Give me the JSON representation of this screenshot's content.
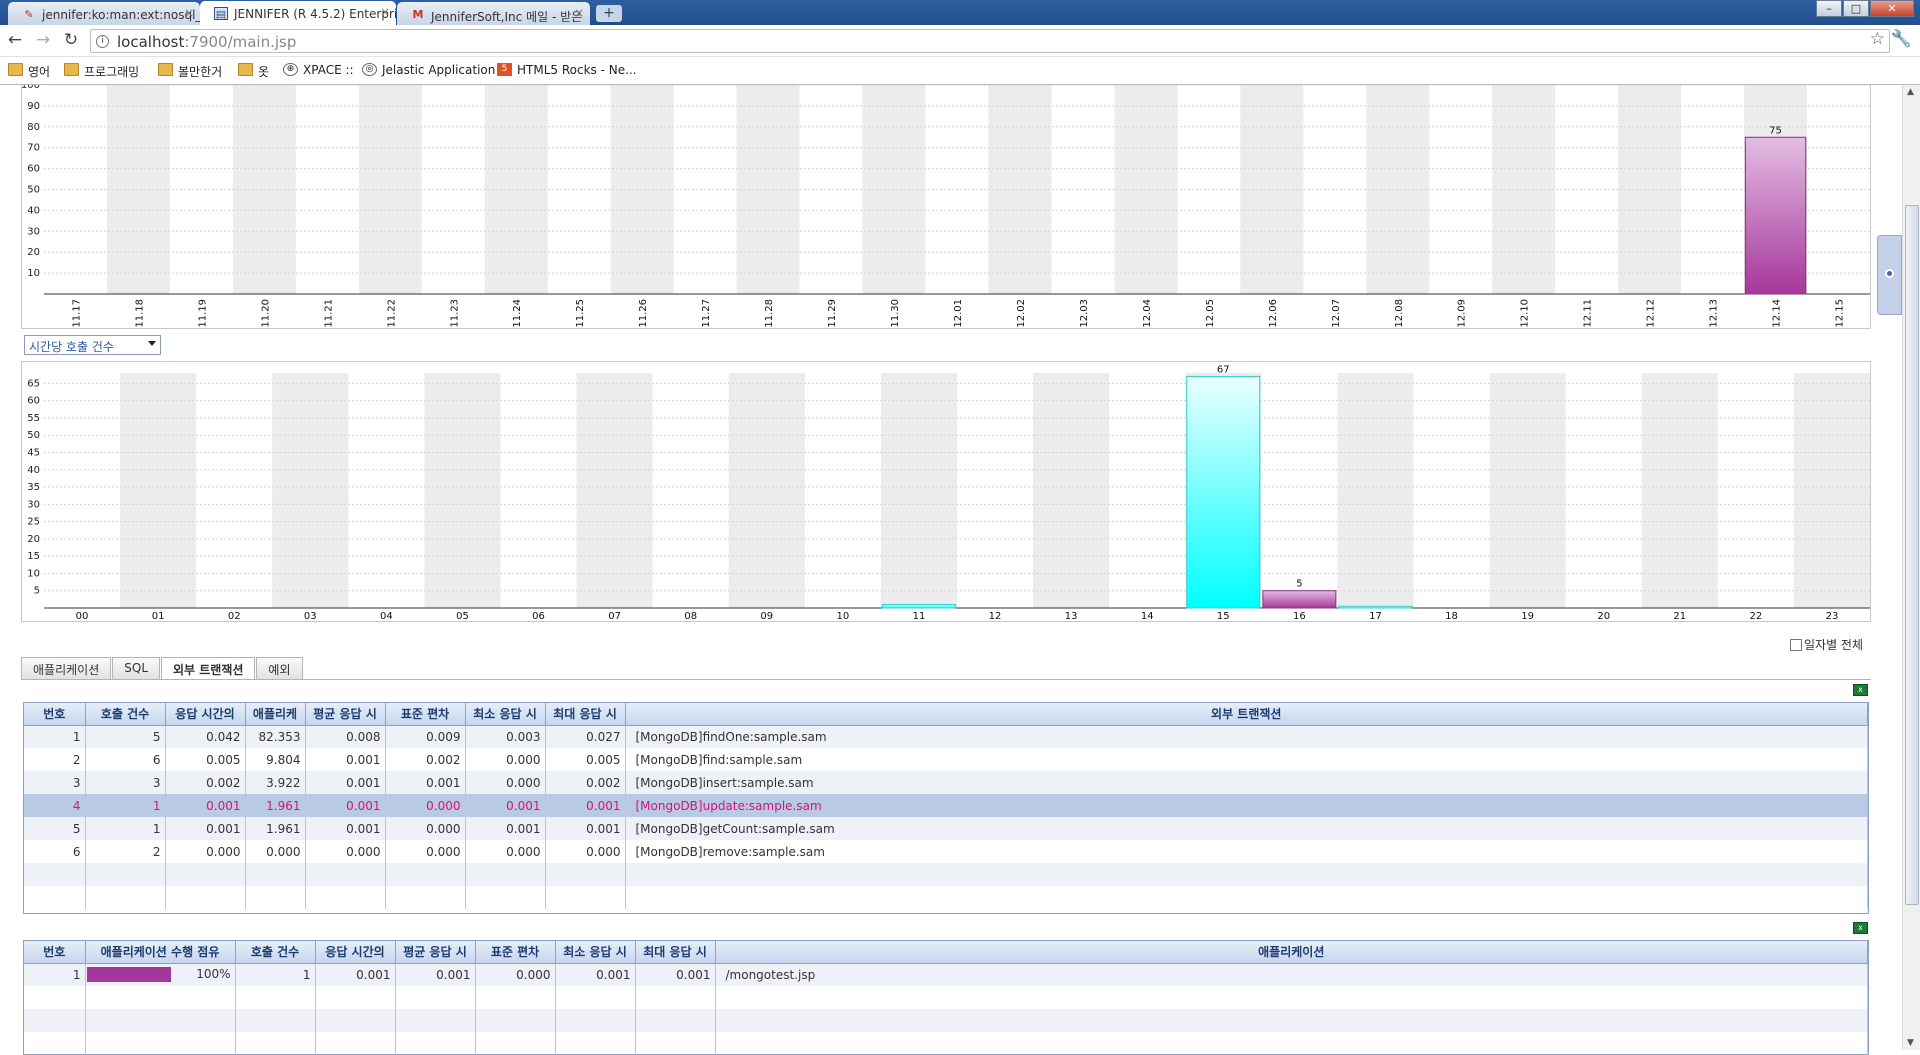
{
  "browser": {
    "tabs": [
      {
        "title": "jennifer:ko:man:ext:nosql_n",
        "icon": "doc-icon"
      },
      {
        "title": "JENNIFER (R 4.5.2) Enterpri",
        "icon": "monitor-icon"
      },
      {
        "title": "JenniferSoft,Inc 메일 - 받은",
        "icon": "mail-icon"
      }
    ],
    "url_host": "localhost",
    "url_rest": ":7900/main.jsp",
    "bookmarks": [
      "영어",
      "프로그래밍",
      "볼만한거",
      "옷",
      "XPACE ::",
      "Jelastic Application",
      "HTML5 Rocks - Ne..."
    ]
  },
  "colors": {
    "purple_bar": "#a5379a",
    "cyan_bar": "#00ffff",
    "grid_header": "#c6d6ee",
    "selected_row_text": "#d6117e"
  },
  "charts": {
    "daily": {
      "type": "bar",
      "categories": [
        "11.17",
        "11.18",
        "11.19",
        "11.20",
        "11.21",
        "11.22",
        "11.23",
        "11.24",
        "11.25",
        "11.26",
        "11.27",
        "11.28",
        "11.29",
        "11.30",
        "12.01",
        "12.02",
        "12.03",
        "12.04",
        "12.05",
        "12.06",
        "12.07",
        "12.08",
        "12.09",
        "12.10",
        "12.11",
        "12.12",
        "12.13",
        "12.14",
        "12.15"
      ],
      "values": [
        0,
        0,
        0,
        0,
        0,
        0,
        0,
        0,
        0,
        0,
        0,
        0,
        0,
        0,
        0,
        0,
        0,
        0,
        0,
        0,
        0,
        0,
        0,
        0,
        0,
        0,
        0,
        75,
        0
      ],
      "ylim": [
        0,
        100
      ],
      "yticks": [
        "10",
        "20",
        "30",
        "40",
        "50",
        "60",
        "70",
        "80",
        "90",
        "100"
      ],
      "data_labels": {
        "27": "75"
      }
    },
    "hourly": {
      "type": "bar",
      "selector": "시간당 호출 건수",
      "categories": [
        "00",
        "01",
        "02",
        "03",
        "04",
        "05",
        "06",
        "07",
        "08",
        "09",
        "10",
        "11",
        "12",
        "13",
        "14",
        "15",
        "16",
        "17",
        "18",
        "19",
        "20",
        "21",
        "22",
        "23"
      ],
      "series": [
        {
          "values": [
            0,
            0,
            0,
            0,
            0,
            0,
            0,
            0,
            0,
            0,
            0,
            1,
            0,
            0,
            0,
            67,
            0,
            0.5,
            0,
            0,
            0,
            0,
            0,
            0
          ],
          "color": "#00ffff"
        },
        {
          "values": [
            0,
            0,
            0,
            0,
            0,
            0,
            0,
            0,
            0,
            0,
            0,
            0,
            0,
            0,
            0,
            0,
            5,
            0,
            0,
            0,
            0,
            0,
            0,
            0
          ],
          "color": "#a5379a"
        }
      ],
      "ylim": [
        0,
        68
      ],
      "yticks": [
        "5",
        "10",
        "15",
        "20",
        "25",
        "30",
        "35",
        "40",
        "45",
        "50",
        "55",
        "60",
        "65"
      ],
      "data_labels": {
        "15": "67",
        "16": "5"
      }
    }
  },
  "daily_total_label": "일자별 전체",
  "tabs": [
    "애플리케이션",
    "SQL",
    "외부 트랜잭션",
    "예외"
  ],
  "ext_table": {
    "headers": [
      "번호",
      "호출 건수",
      "응답 시간의",
      "애플리케",
      "평균 응답 시",
      "표준 편차",
      "최소 응답 시",
      "최대 응답 시",
      "외부 트랜잭션"
    ],
    "rows": [
      [
        "1",
        "5",
        "0.042",
        "82.353",
        "0.008",
        "0.009",
        "0.003",
        "0.027",
        "[MongoDB]findOne:sample.sam"
      ],
      [
        "2",
        "6",
        "0.005",
        "9.804",
        "0.001",
        "0.002",
        "0.000",
        "0.005",
        "[MongoDB]find:sample.sam"
      ],
      [
        "3",
        "3",
        "0.002",
        "3.922",
        "0.001",
        "0.001",
        "0.000",
        "0.002",
        "[MongoDB]insert:sample.sam"
      ],
      [
        "4",
        "1",
        "0.001",
        "1.961",
        "0.001",
        "0.000",
        "0.001",
        "0.001",
        "[MongoDB]update:sample.sam"
      ],
      [
        "5",
        "1",
        "0.001",
        "1.961",
        "0.001",
        "0.000",
        "0.001",
        "0.001",
        "[MongoDB]getCount:sample.sam"
      ],
      [
        "6",
        "2",
        "0.000",
        "0.000",
        "0.000",
        "0.000",
        "0.000",
        "0.000",
        "[MongoDB]remove:sample.sam"
      ]
    ],
    "selected_row": 3
  },
  "app_table": {
    "headers": [
      "번호",
      "애플리케이션 수행 점유",
      "호출 건수",
      "응답 시간의",
      "평균 응답 시",
      "표준 편차",
      "최소 응답 시",
      "최대 응답 시",
      "애플리케이션"
    ],
    "rows": [
      {
        "no": "1",
        "share_pct": "100%",
        "share_value": 1.0,
        "calls": "1",
        "resp_ratio": "0.001",
        "avg": "0.001",
        "std": "0.000",
        "min": "0.001",
        "max": "0.001",
        "app": "/mongotest.jsp"
      }
    ]
  }
}
